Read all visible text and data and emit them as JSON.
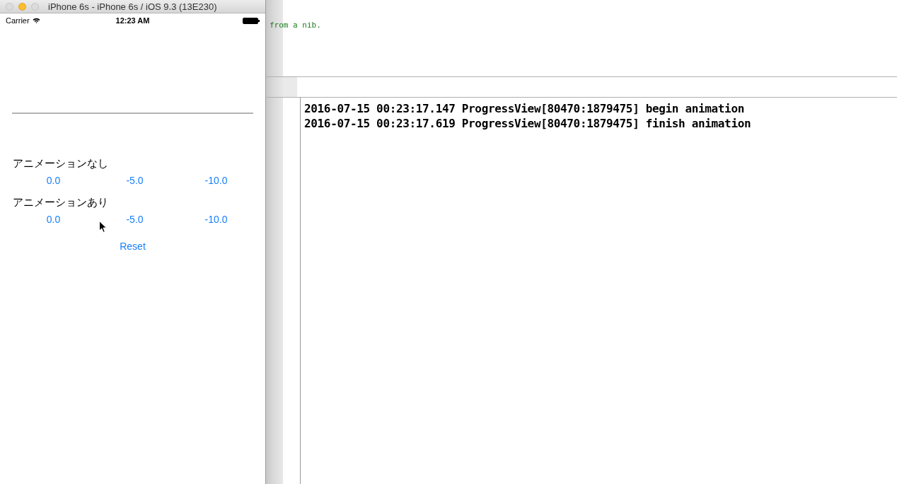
{
  "simulator": {
    "title": "iPhone 6s - iPhone 6s / iOS 9.3 (13E230)",
    "status_bar": {
      "carrier": "Carrier",
      "time": "12:23 AM"
    },
    "progress": {
      "level": 0
    },
    "sections": [
      {
        "label": "アニメーションなし",
        "buttons": [
          "0.0",
          "-5.0",
          "-10.0"
        ]
      },
      {
        "label": "アニメーションあり",
        "buttons": [
          "0.0",
          "-5.0",
          "-10.0"
        ]
      }
    ],
    "reset_button": "Reset"
  },
  "editor": {
    "code_fragment": "from a nib."
  },
  "console": {
    "lines": [
      "2016-07-15 00:23:17.147 ProgressView[80470:1879475] begin animation",
      "2016-07-15 00:23:17.619 ProgressView[80470:1879475] finish animation"
    ]
  }
}
